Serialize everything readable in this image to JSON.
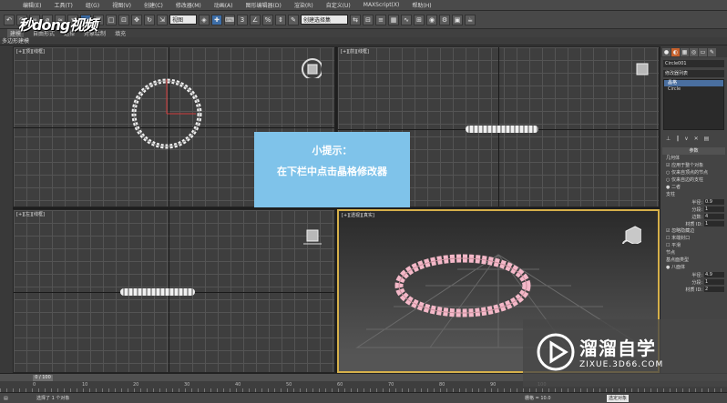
{
  "menubar": {
    "items": [
      "编辑(E)",
      "工具(T)",
      "组(G)",
      "视图(V)",
      "创建(C)",
      "修改器(M)",
      "动画(A)",
      "图形编辑器(D)",
      "渲染(R)",
      "自定义(U)",
      "MAXScript(X)",
      "帮助(H)"
    ]
  },
  "toolbar": {
    "view_select": "视图",
    "selection_set": "创建选择集"
  },
  "ribbon": {
    "tabs": [
      "建模",
      "自由形式",
      "选择",
      "对象绘制",
      "填充"
    ],
    "sub_label": "多边形建模"
  },
  "viewports": {
    "top": "[+][顶][线框]",
    "front": "[+][前][线框]",
    "left": "[+][左][线框]",
    "perspective": "[+][透视][真实]"
  },
  "tip": {
    "title": "小提示：",
    "text": "在下栏中点击晶格修改器"
  },
  "command_panel": {
    "object_name": "Circle001",
    "modifier_list_label": "修改器列表",
    "stack": [
      "晶格",
      "Circle"
    ],
    "params_title": "参数",
    "geometry_group": "几何体",
    "apply_all": "应用于整个对象",
    "options": [
      "仅来自顶点的节点",
      "仅来自边的支柱",
      "二者"
    ],
    "struts_title": "支柱",
    "strut_fields": [
      {
        "label": "半径:",
        "value": "0.9"
      },
      {
        "label": "分段:",
        "value": "1"
      },
      {
        "label": "边数:",
        "value": "4"
      },
      {
        "label": "材质 ID:",
        "value": "1"
      }
    ],
    "checks": [
      "忽略隐藏边",
      "末端封口",
      "平滑"
    ],
    "joints_title": "节点",
    "basetype_label": "基点面类型",
    "basetype_value": "八面体",
    "joint_fields": [
      {
        "label": "半径:",
        "value": "4.9"
      },
      {
        "label": "分段:",
        "value": "1"
      },
      {
        "label": "材质 ID:",
        "value": "2"
      }
    ]
  },
  "timeline": {
    "frame": "0 / 100",
    "ruler": [
      "0",
      "10",
      "20",
      "30",
      "40",
      "50",
      "60",
      "70",
      "80",
      "90",
      "100"
    ]
  },
  "status": {
    "text": "选择了 1 个对象",
    "grid": "栅格 = 10.0",
    "key_filter": "选定对象"
  },
  "watermark": {
    "logo": "秒dong视频",
    "brand": "溜溜自学",
    "url": "ZIXUE.3D66.COM"
  },
  "colors": {
    "tip_bg": "#7fc3ea",
    "active_viewport_border": "#d6b04a",
    "ring": "#f4b8c8"
  }
}
